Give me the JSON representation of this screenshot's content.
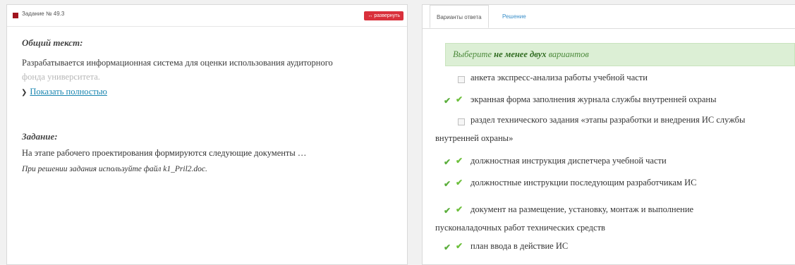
{
  "task": {
    "title": "Задание № 49.3",
    "expand_label": "↔ развернуть",
    "common_heading": "Общий текст:",
    "common_text_visible": "Разрабатывается информационная система для оценки использования аудиторного",
    "common_text_faded": "фонда университета.",
    "show_more_label": "Показать полностью",
    "task_heading": "Задание:",
    "task_text": "На этапе рабочего проектирования формируются следующие документы …",
    "task_note": "При решении задания используйте файл k1_Pril2.doc."
  },
  "tabs": [
    {
      "label": "Варианты ответа",
      "active": true
    },
    {
      "label": "Решение",
      "active": false
    }
  ],
  "notice": {
    "prefix": "Выберите ",
    "bold": "не менее двух",
    "suffix": " вариантов"
  },
  "options": [
    {
      "lines": [
        "анкета экспресс-анализа работы учебной части"
      ],
      "checked": false,
      "correct": false
    },
    {
      "lines": [
        "экранная форма заполнения журнала службы внутренней охраны"
      ],
      "checked": true,
      "correct": true
    },
    {
      "lines": [
        "раздел технического задания «этапы разработки и внедрения ИС службы",
        "внутренней охраны»"
      ],
      "checked": false,
      "correct": false
    },
    {
      "lines": [
        "должностная инструкция диспетчера учебной части"
      ],
      "checked": true,
      "correct": true
    },
    {
      "lines": [
        "должностные инструкции последующим разработчикам ИС"
      ],
      "checked": true,
      "correct": true
    },
    {
      "lines": [
        "документ на размещение, установку, монтаж и выполнение",
        "пусконаладочных работ технических средств"
      ],
      "checked": true,
      "correct": true
    },
    {
      "lines": [
        "план ввода в действие ИС"
      ],
      "checked": true,
      "correct": true
    }
  ]
}
